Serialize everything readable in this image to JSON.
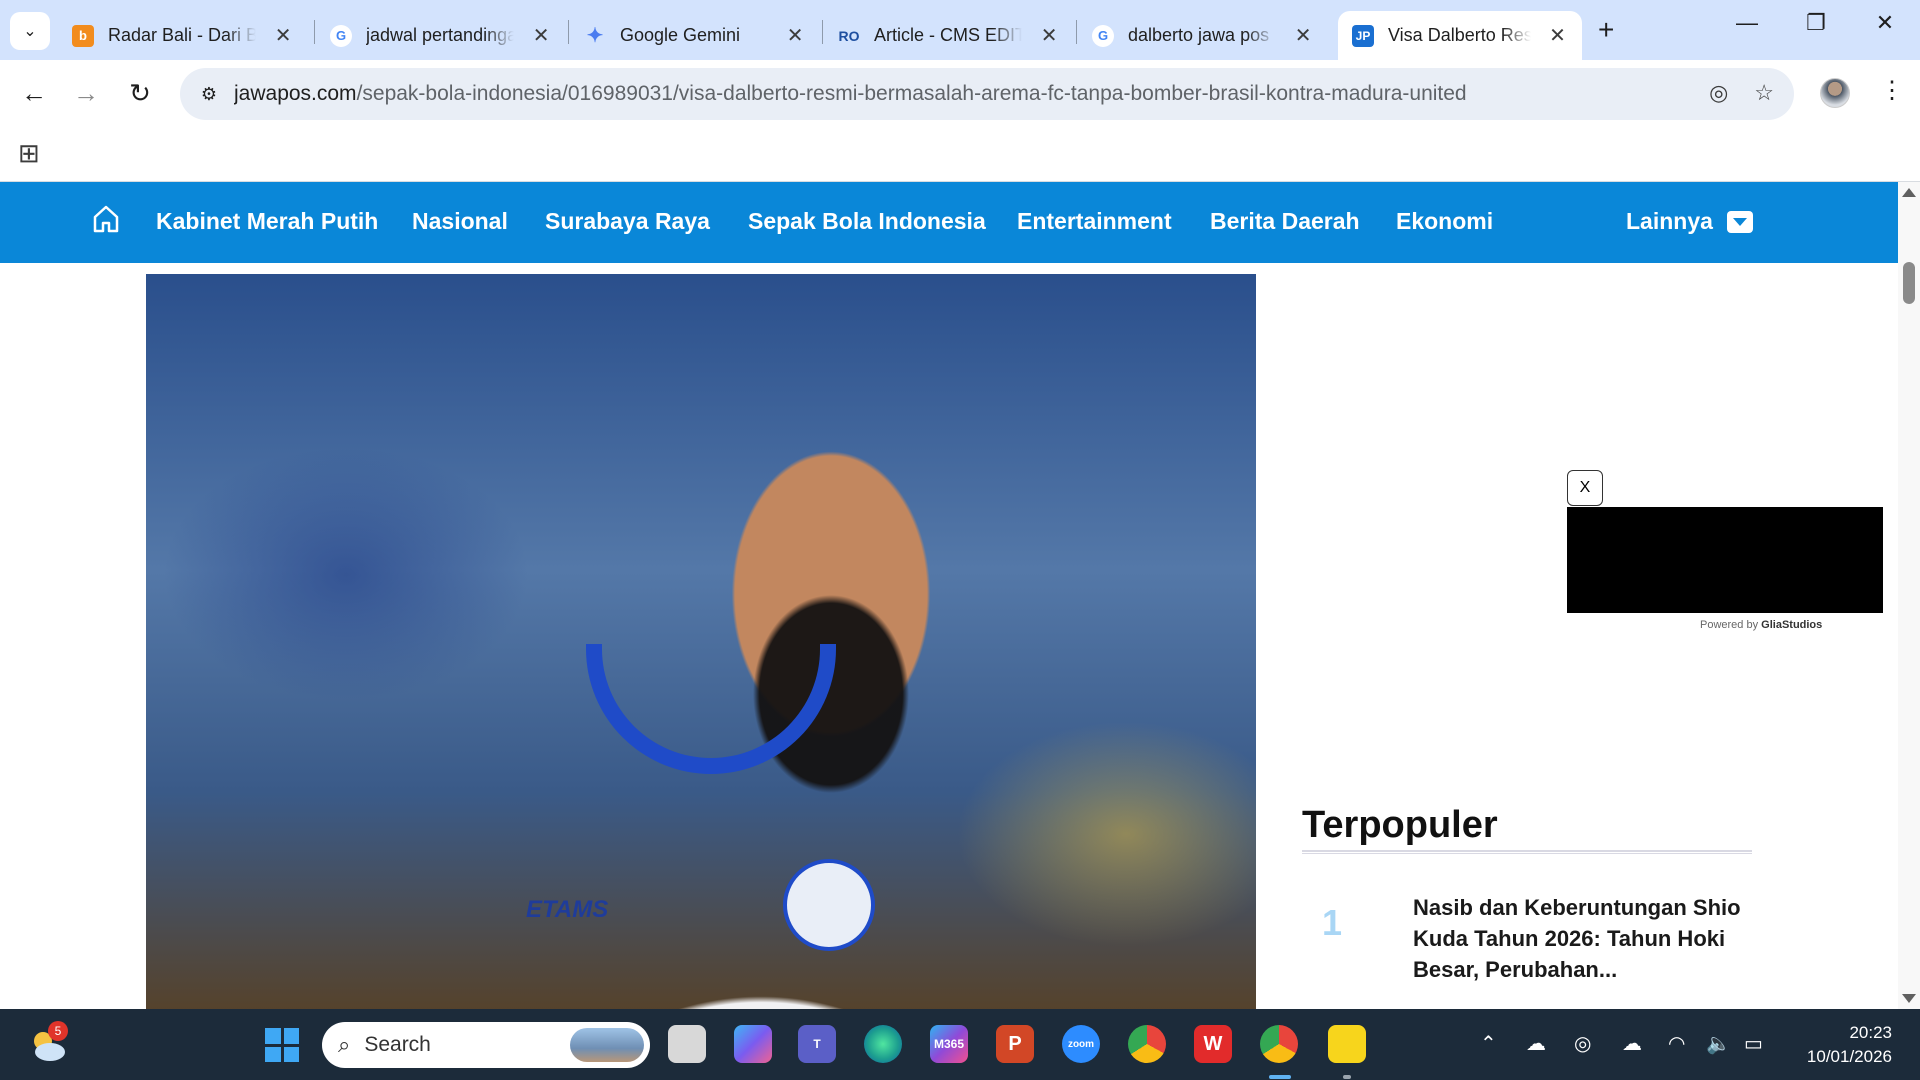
{
  "browser": {
    "tabs": [
      {
        "title": "Radar Bali - Dari Ba",
        "favicon_color": "#f28c1d",
        "favicon_glyph": "b",
        "active": false
      },
      {
        "title": "jadwal pertandinga",
        "favicon_color": "#ffffff",
        "favicon_glyph": "G",
        "active": false
      },
      {
        "title": "Google Gemini",
        "favicon_color": "#ffffff",
        "favicon_glyph": "✦",
        "active": false
      },
      {
        "title": "Article - CMS EDITO",
        "favicon_color": "#ffffff",
        "favicon_glyph": "RO",
        "active": false
      },
      {
        "title": "dalberto jawa pos",
        "favicon_color": "#ffffff",
        "favicon_glyph": "G",
        "active": false
      },
      {
        "title": "Visa Dalberto Resm",
        "favicon_color": "#1a6fd1",
        "favicon_glyph": "JP",
        "active": true
      }
    ],
    "close_glyph": "✕",
    "new_tab_glyph": "+",
    "window_controls": {
      "minimize": "—",
      "restore": "❐",
      "close": "✕"
    },
    "url_host": "jawapos.com",
    "url_path": "/sepak-bola-indonesia/016989031/visa-dalberto-resmi-bermasalah-arema-fc-tanpa-bomber-brasil-kontra-madura-united",
    "icons": {
      "back": "back-arrow-icon",
      "forward": "forward-arrow-icon",
      "reload": "reload-icon",
      "site_info": "tune-icon",
      "eye_off": "eye-off-icon",
      "star": "star-icon",
      "menu": "three-dots-icon",
      "apps": "apps-grid-icon"
    }
  },
  "site": {
    "accent": "#0a87d8",
    "nav": [
      "Kabinet Merah Putih",
      "Nasional",
      "Surabaya Raya",
      "Sepak Bola Indonesia",
      "Entertainment",
      "Berita Daerah",
      "Ekonomi"
    ],
    "more_label": "Lainnya",
    "hero_sponsor_text": "ETAMS",
    "ad": {
      "close_label": "X",
      "powered_prefix": "Powered by",
      "powered_brand": "GliaStudios"
    },
    "popular": {
      "title": "Terpopuler",
      "items": [
        {
          "rank": "1",
          "headline": "Nasib dan Keberuntungan Shio Kuda Tahun 2026: Tahun Hoki Besar, Perubahan..."
        }
      ]
    }
  },
  "taskbar": {
    "weather_badge": "5",
    "search_label": "Search",
    "apps": [
      {
        "name": "task-view",
        "color": "#d8d8d8"
      },
      {
        "name": "copilot",
        "color": "#7a5cf0"
      },
      {
        "name": "teams",
        "color": "#5b5fc7"
      },
      {
        "name": "edge",
        "color": "#1d9f8f"
      },
      {
        "name": "m365",
        "color": "#8f4ad8",
        "label": "M365"
      },
      {
        "name": "powerpoint",
        "color": "#d24726",
        "label": "P"
      },
      {
        "name": "zoom",
        "color": "#2d8cff",
        "label": "zoom"
      },
      {
        "name": "chrome",
        "color": "#e8453c"
      },
      {
        "name": "wps-office",
        "color": "#e22b2b",
        "label": "W"
      },
      {
        "name": "chrome-profile",
        "color": "#34a853"
      },
      {
        "name": "sticky-notes",
        "color": "#f7d51c"
      }
    ],
    "time": "20:23",
    "date": "10/01/2026"
  }
}
